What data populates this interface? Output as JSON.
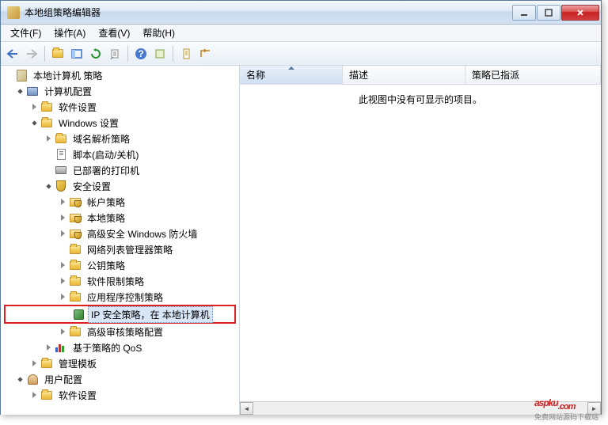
{
  "window": {
    "title": "本地组策略编辑器"
  },
  "menu": {
    "file": "文件(F)",
    "action": "操作(A)",
    "view": "查看(V)",
    "help": "帮助(H)"
  },
  "tree": {
    "root": "本地计算机 策略",
    "computer_config": "计算机配置",
    "software_settings": "软件设置",
    "windows_settings": "Windows 设置",
    "dns_policy": "域名解析策略",
    "scripts": "脚本(启动/关机)",
    "printers": "已部署的打印机",
    "security": "安全设置",
    "account_policy": "帐户策略",
    "local_policy": "本地策略",
    "firewall": "高级安全 Windows 防火墙",
    "network_list": "网络列表管理器策略",
    "public_key": "公钥策略",
    "software_restrict": "软件限制策略",
    "app_control": "应用程序控制策略",
    "ipsec": "IP 安全策略，在 本地计算机",
    "audit": "高级审核策略配置",
    "qos": "基于策略的 QoS",
    "admin_templates": "管理模板",
    "user_config": "用户配置",
    "user_software": "软件设置"
  },
  "list": {
    "col_name": "名称",
    "col_desc": "描述",
    "col_assign": "策略已指派",
    "empty": "此视图中没有可显示的项目。"
  },
  "watermark": {
    "text": "aspku",
    "ext": ".com",
    "sub": "免费网站源码下载站"
  }
}
